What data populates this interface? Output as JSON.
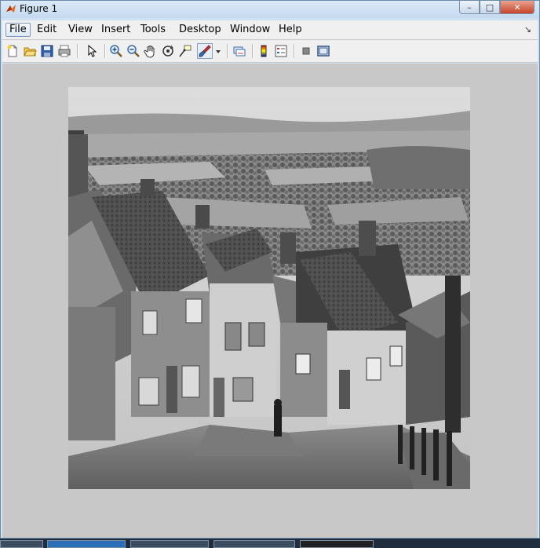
{
  "window": {
    "title": "Figure 1",
    "minimize": "–",
    "maximize": "□",
    "close": "✕"
  },
  "menu": {
    "file": "File",
    "edit": "Edit",
    "view": "View",
    "insert": "Insert",
    "tools": "Tools",
    "desktop": "Desktop",
    "window": "Window",
    "help": "Help",
    "dock_arrow": "↘"
  },
  "toolbar": {
    "tools": [
      "new-figure",
      "open-file",
      "save-figure",
      "print-figure",
      "edit-plot",
      "zoom-in",
      "zoom-out",
      "pan",
      "rotate-3d",
      "data-cursor",
      "brush",
      "brush-dropdown",
      "link-plot",
      "insert-colorbar",
      "insert-legend",
      "hide-plot-tools",
      "show-plot-tools"
    ]
  },
  "colors": {
    "figure_bg": "#c8c8c8",
    "menubar_bg": "#f0f0f0",
    "titlebar": "#cfe0f1",
    "close_button": "#c7442a"
  },
  "image": {
    "description_kind": "grayscale-photo"
  }
}
